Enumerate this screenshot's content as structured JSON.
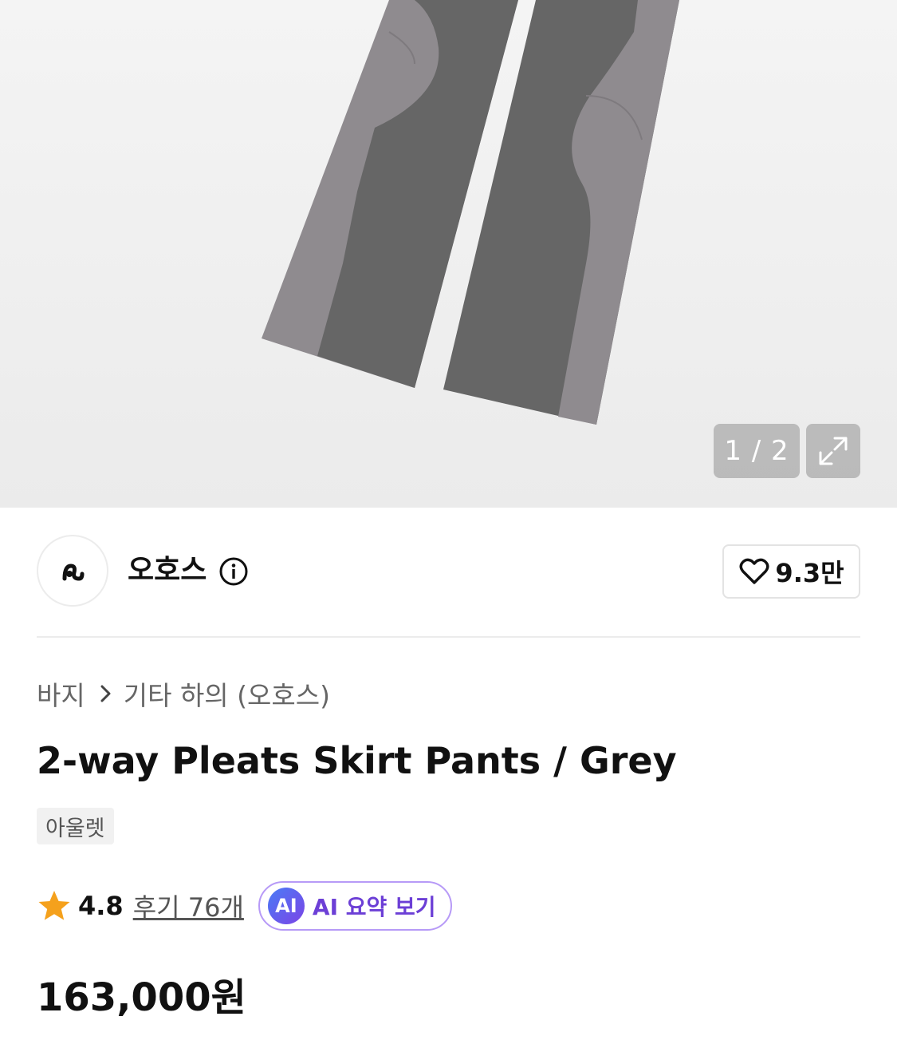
{
  "gallery": {
    "counter": "1 / 2",
    "expand_icon": "expand-arrows-icon"
  },
  "brand": {
    "name": "오호스",
    "info_icon": "info-icon",
    "like_count": "9.3만",
    "like_icon": "heart-outline-icon"
  },
  "breadcrumb": {
    "items": [
      "바지",
      "기타 하의 (오호스)"
    ],
    "separator_icon": "chevron-right-icon"
  },
  "product": {
    "title": "2-way Pleats Skirt Pants / Grey",
    "tag": "아울렛",
    "rating": "4.8",
    "reviews_label": "후기 76개",
    "ai_badge": "AI",
    "ai_button_label": "AI 요약 보기",
    "price": "163,000원"
  },
  "colors": {
    "star": "#f5a11c",
    "ai_accent": "#6c3fd6",
    "ai_border": "#b79af7"
  }
}
